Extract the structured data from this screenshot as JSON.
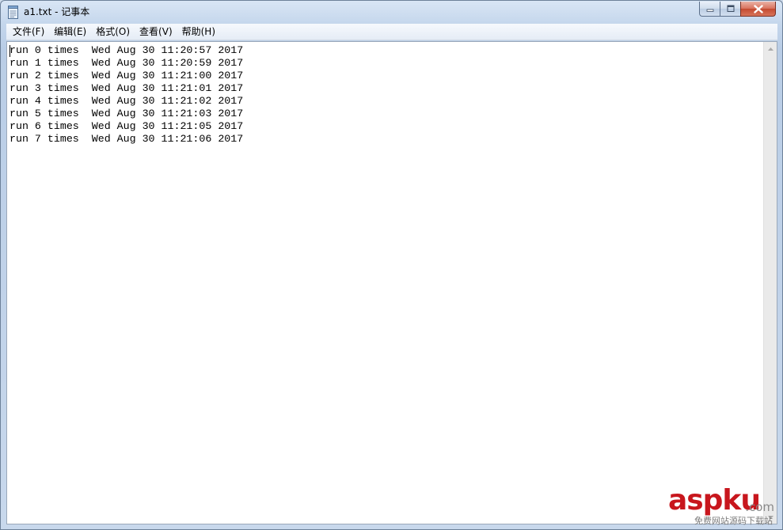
{
  "window": {
    "title": "a1.txt - 记事本",
    "icon": "notepad-icon"
  },
  "caption_buttons": {
    "minimize": "minimize-icon",
    "maximize": "maximize-icon",
    "close": "close-icon"
  },
  "menu": {
    "items": [
      {
        "label": "文件(F)"
      },
      {
        "label": "编辑(E)"
      },
      {
        "label": "格式(O)"
      },
      {
        "label": "查看(V)"
      },
      {
        "label": "帮助(H)"
      }
    ]
  },
  "editor": {
    "lines": [
      "run 0 times  Wed Aug 30 11:20:57 2017",
      "run 1 times  Wed Aug 30 11:20:59 2017",
      "run 2 times  Wed Aug 30 11:21:00 2017",
      "run 3 times  Wed Aug 30 11:21:01 2017",
      "run 4 times  Wed Aug 30 11:21:02 2017",
      "run 5 times  Wed Aug 30 11:21:03 2017",
      "run 6 times  Wed Aug 30 11:21:05 2017",
      "run 7 times  Wed Aug 30 11:21:06 2017"
    ]
  },
  "watermark": {
    "brand": "aspku",
    "suffix": ".com",
    "tagline": "免费网站源码下载站"
  },
  "colors": {
    "watermark_red": "#c8161d",
    "frame_blue": "#c4d6ec"
  }
}
